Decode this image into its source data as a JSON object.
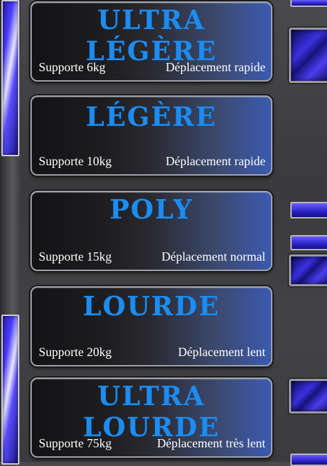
{
  "cards": [
    {
      "title": "ULTRA LÉGÈRE",
      "support": "Supporte 6kg",
      "speed": "Déplacement rapide"
    },
    {
      "title": "LÉGÈRE",
      "support": "Supporte 10kg",
      "speed": "Déplacement rapide"
    },
    {
      "title": "POLY",
      "support": "Supporte 15kg",
      "speed": "Déplacement normal"
    },
    {
      "title": "LOURDE",
      "support": "Supporte 20kg",
      "speed": "Déplacement lent"
    },
    {
      "title": "ULTRA LOURDE",
      "support": "Supporte 75kg",
      "speed": "Déplacement très lent"
    }
  ],
  "colors": {
    "title_blue": "#1d8cf0",
    "neon_blue": "#4b3cff"
  }
}
